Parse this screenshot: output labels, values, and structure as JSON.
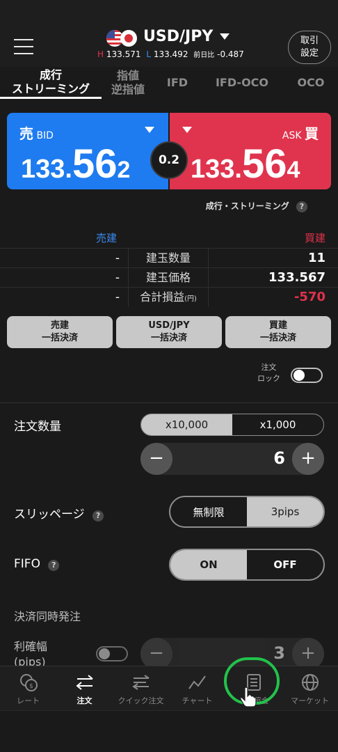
{
  "header": {
    "pair": "USD/JPY",
    "high_prefix": "H",
    "high": "133.571",
    "low_prefix": "L",
    "low": "133.492",
    "change_label": "前日比",
    "change": "-0.487",
    "settings_line1": "取引",
    "settings_line2": "設定"
  },
  "tabs": [
    {
      "line1": "成行",
      "line2": "ストリーミング",
      "active": true
    },
    {
      "line1": "指値",
      "line2": "逆指値",
      "active": false
    },
    {
      "line1": "IFD",
      "line2": "",
      "active": false
    },
    {
      "line1": "IFD-OCO",
      "line2": "",
      "active": false
    },
    {
      "line1": "OCO",
      "line2": "",
      "active": false
    }
  ],
  "bid": {
    "label_jp": "売",
    "label_en": "BID",
    "price_small": "133.",
    "price_big": "56",
    "price_pip": "2"
  },
  "ask": {
    "label_jp": "買",
    "label_en": "ASK",
    "price_small": "133.",
    "price_big": "56",
    "price_pip": "4"
  },
  "spread": "0.2",
  "order_type_label": "成行・ストリーミング",
  "positions": {
    "sell_header": "売建",
    "buy_header": "買建",
    "rows": [
      {
        "label": "建玉数量",
        "unit": "",
        "sell": "-",
        "buy": "11"
      },
      {
        "label": "建玉価格",
        "unit": "",
        "sell": "-",
        "buy": "133.567"
      },
      {
        "label": "合計損益",
        "unit": "(円)",
        "sell": "-",
        "buy": "-570"
      }
    ]
  },
  "bulk_buttons": [
    {
      "line1": "売建",
      "line2": "一括決済"
    },
    {
      "line1": "USD/JPY",
      "line2": "一括決済"
    },
    {
      "line1": "買建",
      "line2": "一括決済"
    }
  ],
  "order_lock": {
    "line1": "注文",
    "line2": "ロック",
    "on": false
  },
  "quantity": {
    "label": "注文数量",
    "options": [
      "x10,000",
      "x1,000"
    ],
    "selected": "x10,000",
    "value": "6",
    "minus": "−",
    "plus": "+"
  },
  "slippage": {
    "label": "スリッページ",
    "options": [
      "無制限",
      "3pips"
    ],
    "selected": "3pips"
  },
  "fifo": {
    "label": "FIFO",
    "options": [
      "ON",
      "OFF"
    ],
    "selected": "ON"
  },
  "simultaneous": {
    "label": "決済同時発注"
  },
  "profit_width": {
    "label_line1": "利確幅",
    "label_line2": "(pips)",
    "value": "3",
    "enabled": false,
    "minus": "−",
    "plus": "+"
  },
  "nav": [
    {
      "label": "レート",
      "icon": "rate-icon",
      "active": false
    },
    {
      "label": "注文",
      "icon": "order-icon",
      "active": true
    },
    {
      "label": "クイック注文",
      "icon": "quick-order-icon",
      "active": false
    },
    {
      "label": "チャート",
      "icon": "chart-icon",
      "active": false
    },
    {
      "label": "照会",
      "icon": "inquiry-icon",
      "active": false
    },
    {
      "label": "マーケット",
      "icon": "market-icon",
      "active": false
    }
  ],
  "colors": {
    "bid": "#1e7bf0",
    "ask": "#e0344e",
    "loss": "#e0324b",
    "background": "#1a1a1a",
    "highlight": "#22c24a"
  }
}
